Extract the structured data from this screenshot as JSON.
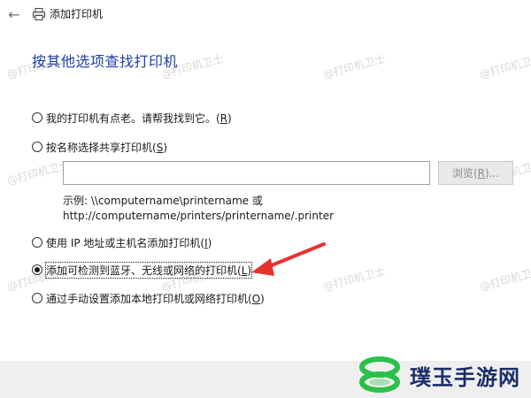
{
  "window": {
    "back_glyph": "←",
    "title": "添加打印机",
    "icon": "printer-icon"
  },
  "heading": "按其他选项查找打印机",
  "options": [
    {
      "label": "我的打印机有点老。请帮我找到它。(",
      "accel": "R",
      "end": ")",
      "checked": false
    },
    {
      "label": "按名称选择共享打印机(",
      "accel": "S",
      "end": ")",
      "checked": false
    },
    {
      "label": "使用 IP 地址或主机名添加打印机(",
      "accel": "I",
      "end": ")",
      "checked": false
    },
    {
      "label": "添加可检测到蓝牙、无线或网络的打印机(",
      "accel": "L",
      "end": ")",
      "checked": true
    },
    {
      "label": "通过手动设置添加本地打印机或网络打印机(",
      "accel": "O",
      "end": ")",
      "checked": false
    }
  ],
  "shared_printer": {
    "input_value": "",
    "browse_label": "浏览(",
    "browse_accel": "R",
    "browse_end": ")...",
    "example_line1": "示例: \\\\computername\\printername 或",
    "example_line2": "http://computername/printers/printername/.printer"
  },
  "watermark": "@打印机卫士",
  "brand": {
    "name": "璞玉手游网"
  },
  "colors": {
    "heading": "#1c3fa6",
    "arrow": "#e8312f",
    "brand_text": "#1b2d6b",
    "brand_green": "#2cbf4a"
  }
}
